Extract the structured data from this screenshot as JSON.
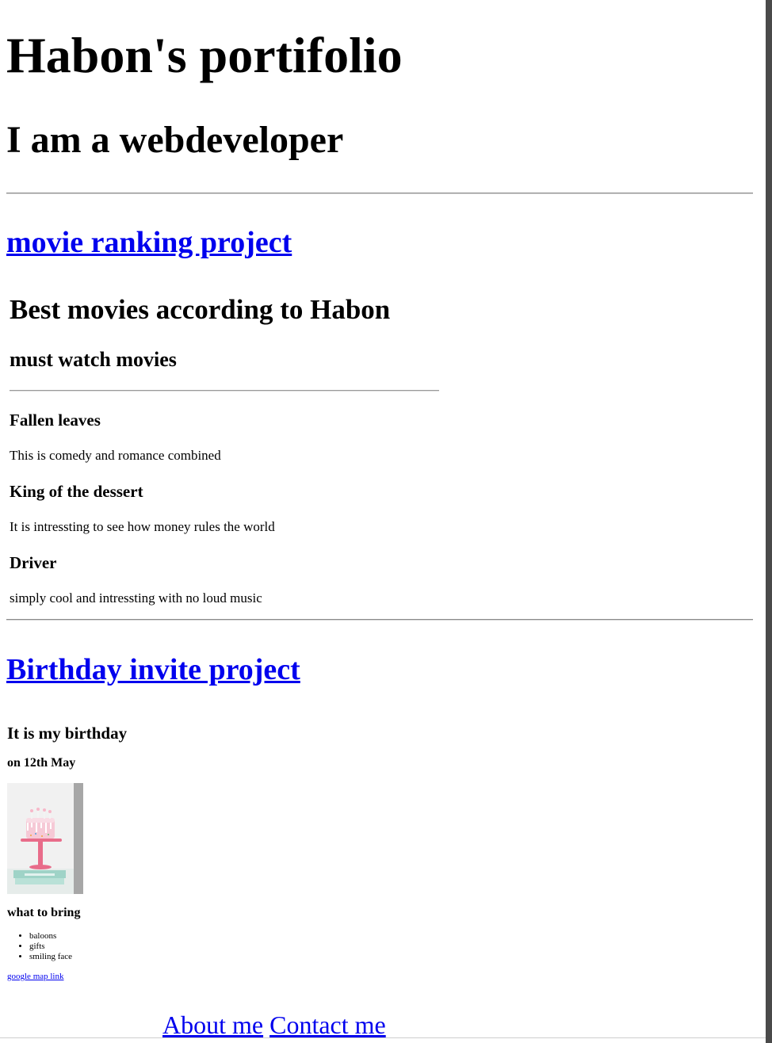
{
  "header": {
    "title": "Habon's portifolio",
    "subtitle": "I am a webdeveloper"
  },
  "projects": {
    "movie_link": "movie ranking project",
    "birthday_link": "Birthday invite project"
  },
  "movie": {
    "title": "Best movies according to Habon",
    "subtitle": "must watch movies",
    "items": [
      {
        "name": "Fallen leaves",
        "description": "This is comedy and romance combined"
      },
      {
        "name": "King of the dessert",
        "description": "It is intressting to see how money rules the world"
      },
      {
        "name": "Driver",
        "description": "simply cool and intressting with no loud music"
      }
    ]
  },
  "birthday": {
    "title": "It is my birthday",
    "date": "on 12th May",
    "bring_title": "what to bring",
    "bring_items": [
      "baloons",
      "gifts",
      "smiling face"
    ],
    "map_link": "google map link"
  },
  "footer": {
    "about": "About me",
    "contact": "Contact me"
  }
}
